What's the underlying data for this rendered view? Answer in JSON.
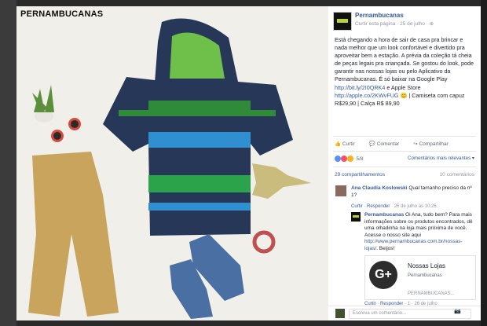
{
  "brand": {
    "label": "PERNAMBUCANAS"
  },
  "post": {
    "page_name": "Pernambucanas",
    "meta": "Curtir esta página · 25 de julho · ⊕",
    "text_part1": "Está chegando a hora de sair de casa pra brincar e nada melhor que um look confortável e divertido pra aproveitar bem a estação. A prévia da coleção tá cheia de peças legais pra criançada. Se gostou do look, pode garantir nas nossas lojas ou pelo Aplicativo da Pernambucanas. É só baixar na Google Play ",
    "link1": "http://bit.ly/2I0QRK4",
    "text_part2": " e Apple Store ",
    "link2": "http://apple.co/2KWvFUG",
    "text_part3": " 😊 | Camiseta com capuz R$29,90 | Calça R$ 89,90"
  },
  "actions": {
    "like": "Curtir",
    "comment": "Comentar",
    "share": "Compartilhar"
  },
  "reactions": {
    "count": "5/8",
    "relevance": "Comentários mais relevantes ▾"
  },
  "stats": {
    "shares": "29 compartilhamentos",
    "comments": "10 comentários"
  },
  "comment1": {
    "name": "Ana Claudia Koslowski",
    "text": " Qual tamanho preciso da nº 1?",
    "like": "Curtir",
    "reply": "Responder",
    "time": " · 26 de julho às 10:26"
  },
  "comment2": {
    "name": "Pernambucanas",
    "text": " Oi Ana, tudo bem? Para mais informações sobre os produtos encontrados, dê uma olhadinha na loja mais próxima de você. Acesse o nosso site aqui ",
    "link": "http://www.pernambucanas.com.br/nossas-lojas/",
    "text2": ". Beijos!"
  },
  "link_card": {
    "title": "Nossas Lojas",
    "subtitle": "Pernambucanas",
    "domain": "PERNAMBUCANAS...",
    "icon": "G+"
  },
  "comment2_meta": {
    "like": "Curtir",
    "reply": "Responder",
    "time": " · 1 · 26 de julho"
  },
  "write_comment": {
    "placeholder": "Escreva um comentário..."
  },
  "colors": {
    "link": "#365899",
    "brand_green": "#b6d33a"
  }
}
